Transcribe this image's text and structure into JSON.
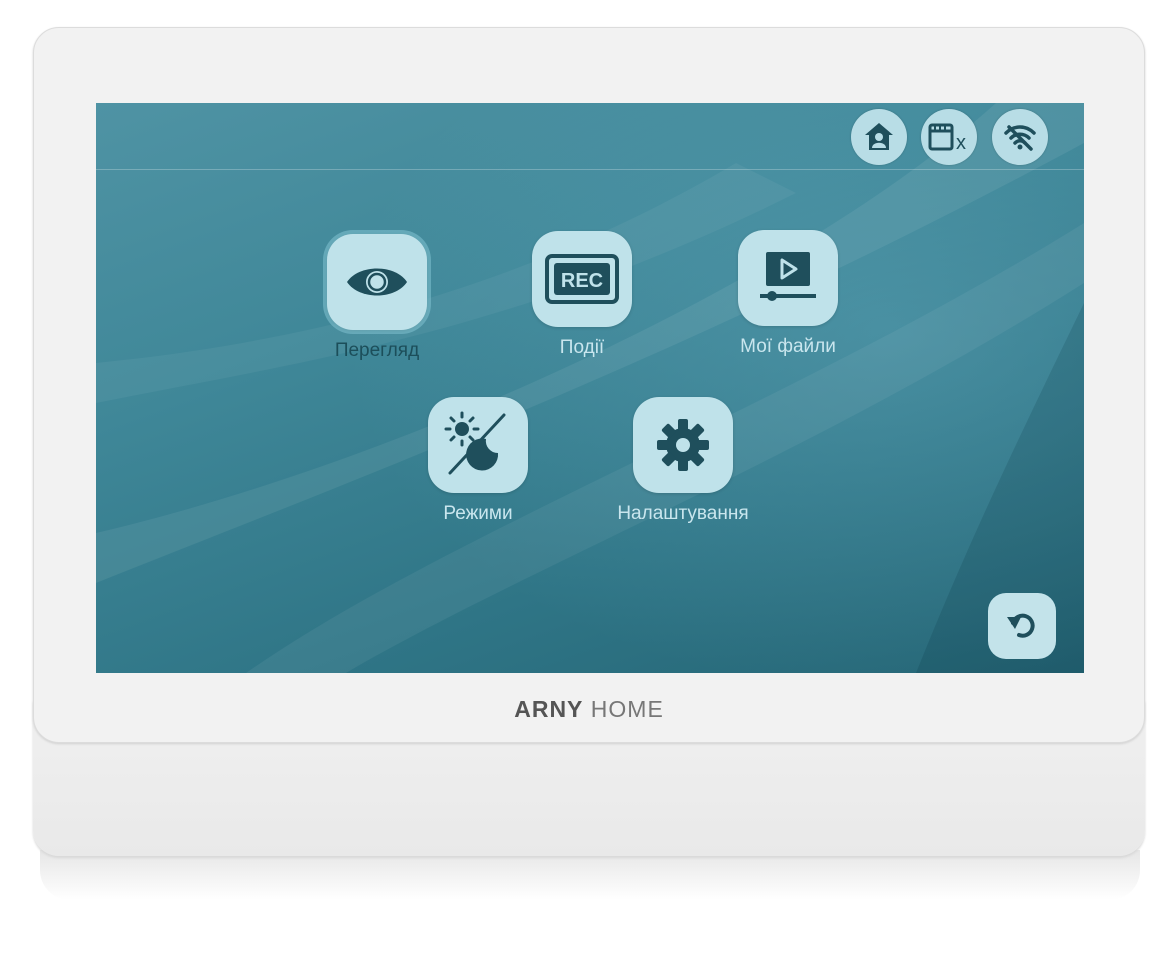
{
  "device": {
    "brand_bold": "ARNY",
    "brand_light": "HOME"
  },
  "status_bar": {
    "icons": [
      "home-user-icon",
      "sd-card-missing-icon",
      "wifi-off-icon"
    ],
    "sd_mark": "x"
  },
  "menu": {
    "items": [
      {
        "label": "Перегляд",
        "icon": "eye-icon",
        "active": true
      },
      {
        "label": "Події",
        "icon": "rec-icon",
        "badge": "REC"
      },
      {
        "label": "Мої файли",
        "icon": "video-files-icon"
      },
      {
        "label": "Режими",
        "icon": "day-night-icon"
      },
      {
        "label": "Налаштування",
        "icon": "gear-icon"
      }
    ]
  },
  "colors": {
    "screen_bg": "#3f8798",
    "tile_bg": "#bfe2ea",
    "icon_dark": "#1f4f5c"
  },
  "back_button": {
    "icon": "back-arrow-icon"
  }
}
